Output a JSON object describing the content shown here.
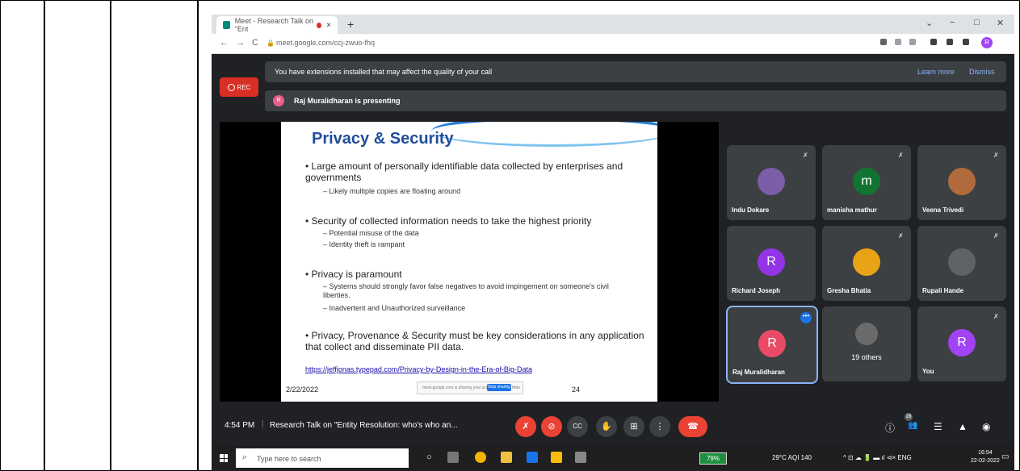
{
  "browser": {
    "tab_title": "Meet - Research Talk on \"Ent",
    "tab_close": "×",
    "new_tab": "+",
    "url": "meet.google.com/ccj-zwuo-fhq",
    "profile_initial": "R",
    "nav_back": "←",
    "nav_forward": "→",
    "nav_reload": "C",
    "win_chevron": "⌄",
    "win_min": "−",
    "win_max": "□",
    "win_close": "✕"
  },
  "banner": {
    "message": "You have extensions installed that may affect the quality of your call",
    "learn_more": "Learn more",
    "dismiss": "Dismiss"
  },
  "rec_label": "REC",
  "presenting": {
    "initial": "R",
    "text": "Raj Muralidharan is presenting"
  },
  "slide": {
    "title": "Privacy & Security",
    "bullets": [
      {
        "text": "• Large amount of personally identifiable data collected by enterprises and governments",
        "subs": [
          "–  Likely multiple copies are floating around"
        ]
      },
      {
        "text": "• Security of collected information needs to take the highest priority",
        "subs": [
          "–  Potential misuse of the data",
          "–  Identity theft is rampant"
        ]
      },
      {
        "text": "• Privacy is paramount",
        "subs": [
          "–  Systems should strongly favor false negatives to avoid impingement on someone's civil liberties.",
          "–  Inadvertent and Unauthorized surveillance"
        ]
      },
      {
        "text": "• Privacy, Provenance & Security must be key considerations in any application that collect and disseminate PII data.",
        "subs": []
      }
    ],
    "link": "https://jeffjonas.typepad.com/Privacy-by-Design-in-the-Era-of-Big-Data",
    "date": "2/22/2022",
    "page": "24",
    "share_text": "meet.google.com is sharing your screen.",
    "stop_sharing": "Stop sharing",
    "hide": "Hide"
  },
  "participants": [
    {
      "name": "Indu Dokare",
      "initial": "",
      "color": "#7b5ea7"
    },
    {
      "name": "manisha mathur",
      "initial": "m",
      "color": "#137333"
    },
    {
      "name": "Veena Trivedi",
      "initial": "",
      "color": "#b06a3b"
    },
    {
      "name": "Richard Joseph",
      "initial": "R",
      "color": "#9334e6"
    },
    {
      "name": "Gresha Bhatia",
      "initial": "",
      "color": "#e8a317"
    },
    {
      "name": "Rupali Hande",
      "initial": "",
      "color": "#5f6368"
    },
    {
      "name": "Raj Muralidharan",
      "initial": "R",
      "color": "#e94b67"
    },
    {
      "name": "",
      "initial": "",
      "color": "#6b6b6b",
      "others": "19 others"
    },
    {
      "name": "You",
      "initial": "R",
      "color": "#a142f4"
    }
  ],
  "more_dots": "•••",
  "mic_off_glyph": "✗",
  "bottom": {
    "time": "4:54 PM",
    "separator": "|",
    "meeting_title": "Research Talk on \"Entity Resolution: who's who an...",
    "mic_off": "✗",
    "cam_off": "⊘",
    "captions": "CC",
    "hand": "✋",
    "present": "⊞",
    "more": "⋮",
    "end_call": "☎",
    "info": "ⓘ",
    "people": "👥",
    "people_count": "28",
    "chat": "☰",
    "activities": "▲",
    "safety": "◉"
  },
  "taskbar": {
    "search_glyph": "⌕",
    "search_placeholder": "Type here to search",
    "task_view": "○",
    "battery": "79%",
    "weather": "29°C  AQI 140",
    "tray_icons": "^  ⊡  ☁  🔋  ▬  ıl  ⊲×  ENG",
    "time": "16:54",
    "date": "22-02-2022",
    "notify": "▭"
  }
}
